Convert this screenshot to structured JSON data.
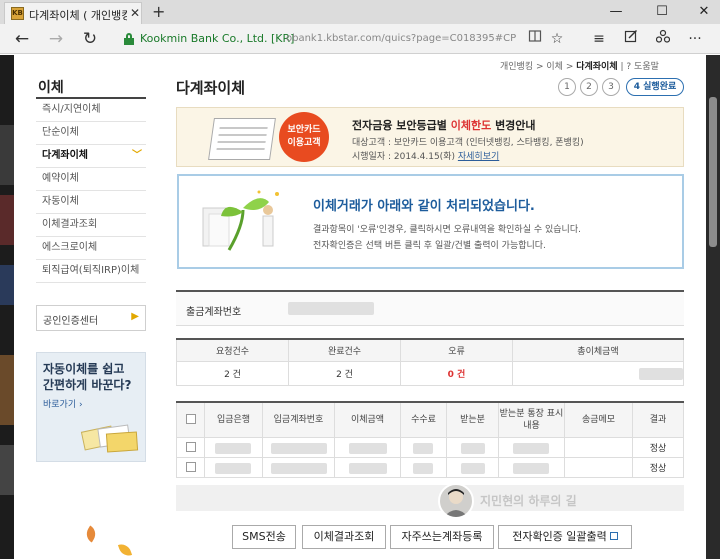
{
  "browser": {
    "tab_title": "다계좌이체 ( 개인뱅킹",
    "tab_close": "✕",
    "new_tab": "+",
    "favicon_text": "KB",
    "minimize": "—",
    "maximize": "☐",
    "close": "✕",
    "back": "←",
    "forward": "→",
    "refresh": "↻",
    "cert_name": "Kookmin Bank Co., Ltd. [KR]",
    "url": "obank1.kbstar.com/quics?page=C018395#CP",
    "icons": [
      "reading-view-icon",
      "favorite-star-icon",
      "hub-icon",
      "web-note-icon",
      "share-icon",
      "more-icon"
    ]
  },
  "breadcrumb": {
    "items": [
      "개인뱅킹",
      "이체",
      "다계좌이체"
    ],
    "help": "도움말"
  },
  "sidebar": {
    "title": "이체",
    "items": [
      "즉시/지연이체",
      "단순이체",
      "다계좌이체",
      "예약이체",
      "자동이체",
      "이체결과조회",
      "에스크로이체",
      "퇴직급여(퇴직IRP)이체"
    ],
    "active_index": 2,
    "cert_center": "공인인증센터",
    "promo_title_line1": "자동이체를 쉽고",
    "promo_title_line2": "간편하게 바꾼다?",
    "promo_link": "바로가기 ›"
  },
  "main": {
    "title": "다계좌이체",
    "steps": [
      "1",
      "2",
      "3"
    ],
    "step_current": "4 실행완료",
    "notice1": {
      "badge_line1": "보안카드",
      "badge_line2": "이용고객",
      "title_pre": "전자금융 보안등급별 ",
      "title_em": "이체한도",
      "title_post": " 변경안내",
      "line1": "대상고객 : 보안카드 이용고객 (인터넷뱅킹, 스타뱅킹, 폰뱅킹)",
      "line2": "시행일자 : 2014.4.15(화)",
      "link": "자세히보기"
    },
    "notice2": {
      "title": "이체거래가 아래와 같이 처리되었습니다.",
      "line1": "결과항목이 '오류'인경우, 클릭하시면 오류내역을 확인하실 수 있습니다.",
      "line2": "전자확인증은 선택 버튼 클릭 후 일괄/건별 출력이 가능합니다."
    },
    "account_label": "출금계좌번호",
    "summary": {
      "headers": [
        "요청건수",
        "완료건수",
        "오류",
        "총이체금액"
      ],
      "values": [
        "2 건",
        "2 건",
        "0 건",
        ""
      ]
    },
    "detail": {
      "headers": [
        "",
        "입금은행",
        "입금계좌번호",
        "이체금액",
        "수수료",
        "받는분",
        "받는분 통장 표시 내용",
        "송금메모",
        "결과"
      ],
      "rows": [
        {
          "result": "정상"
        },
        {
          "result": "정상"
        }
      ]
    },
    "buttons": [
      "SMS전송",
      "이체결과조회",
      "자주쓰는계좌등록",
      "전자확인증 일괄출력"
    ],
    "watermark": "지민현의 하루의 길"
  }
}
